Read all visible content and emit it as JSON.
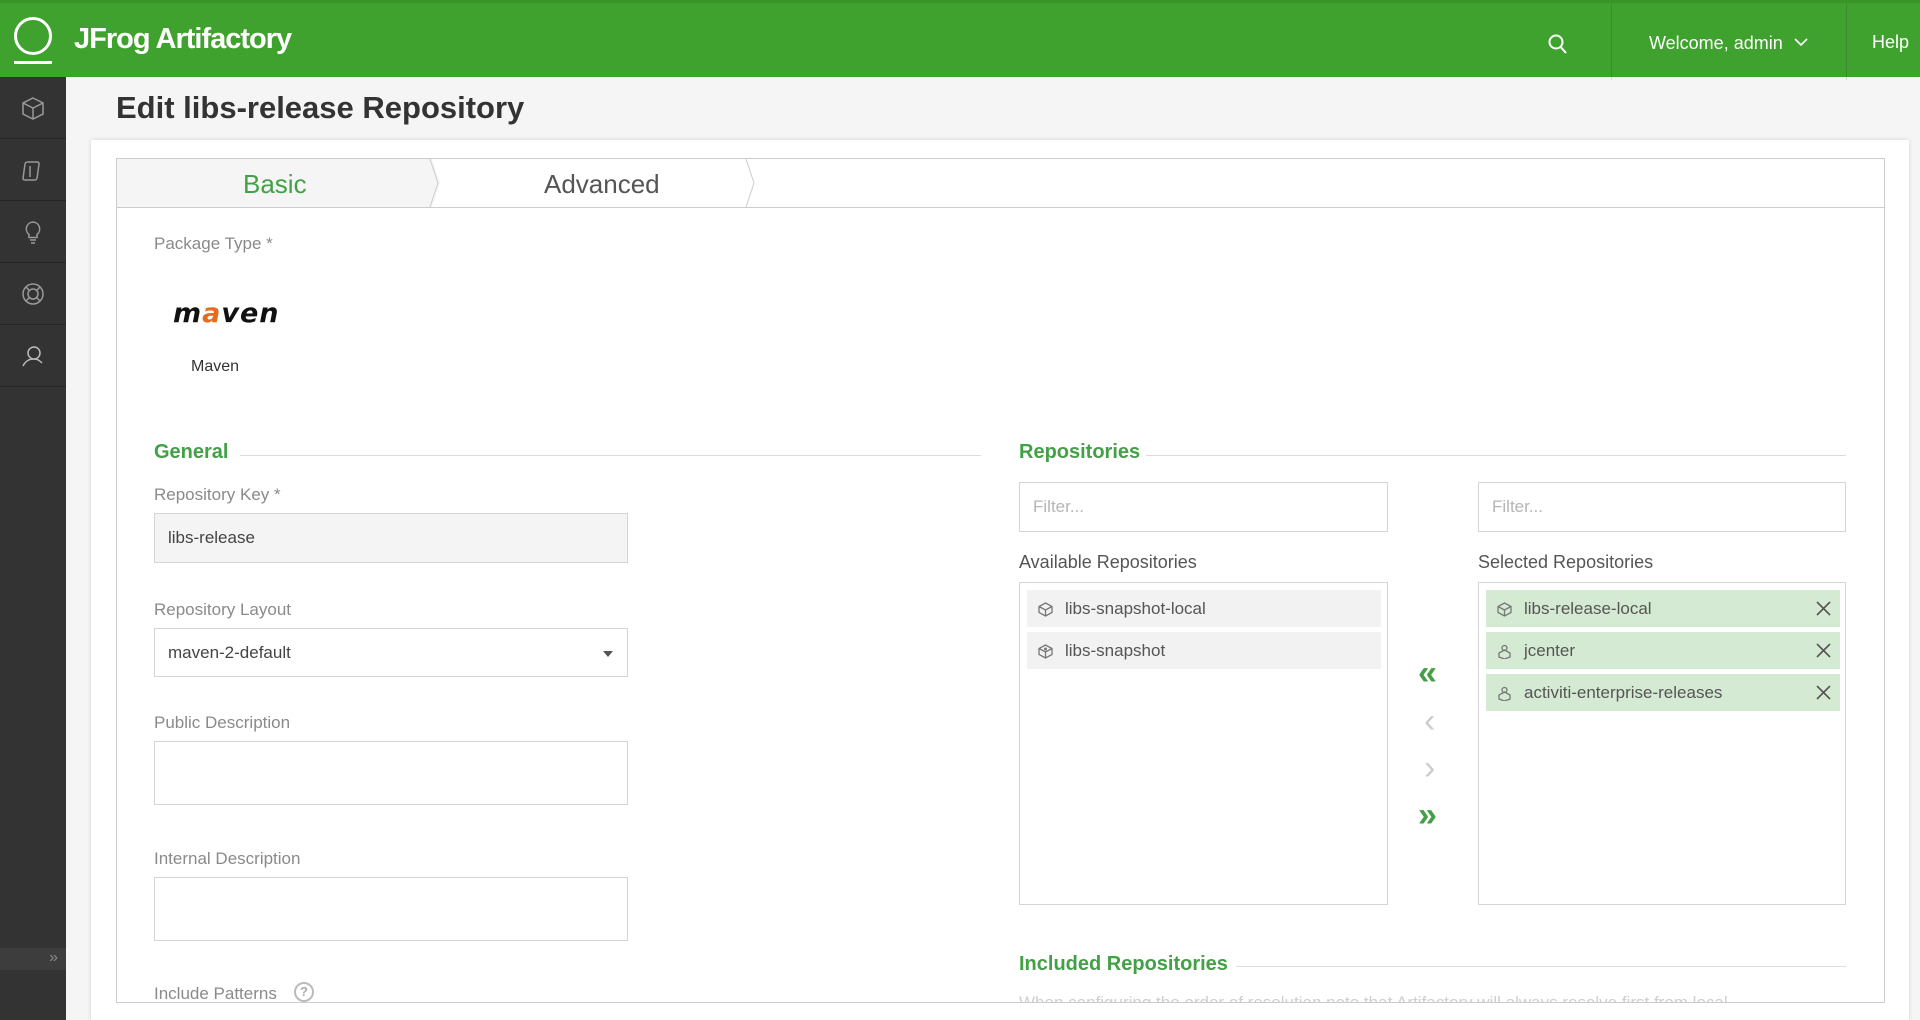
{
  "header": {
    "brand": "JFrog Artifactory",
    "welcome": "Welcome, admin",
    "help": "Help"
  },
  "sidebar": {
    "items": [
      {
        "icon": "cube-icon",
        "name": "artifacts"
      },
      {
        "icon": "package-icon",
        "name": "builds"
      },
      {
        "icon": "lightbulb-icon",
        "name": "home"
      },
      {
        "icon": "lifebuoy-icon",
        "name": "support"
      },
      {
        "icon": "admin-user-icon",
        "name": "admin"
      }
    ],
    "expand_label": "»"
  },
  "page": {
    "title": "Edit libs-release Repository"
  },
  "tabs": [
    {
      "label": "Basic",
      "active": true
    },
    {
      "label": "Advanced",
      "active": false
    }
  ],
  "basic": {
    "package_type_label": "Package Type *",
    "package_logo": "maven",
    "package_name": "Maven",
    "general_title": "General",
    "repo_key_label": "Repository Key *",
    "repo_key_value": "libs-release",
    "layout_label": "Repository Layout",
    "layout_value": "maven-2-default",
    "public_desc_label": "Public Description",
    "internal_desc_label": "Internal Description",
    "include_patterns_label": "Include Patterns"
  },
  "repositories": {
    "title": "Repositories",
    "available_filter_placeholder": "Filter...",
    "selected_filter_placeholder": "Filter...",
    "available_label": "Available Repositories",
    "selected_label": "Selected Repositories",
    "available": [
      "libs-snapshot-local",
      "libs-snapshot"
    ],
    "selected": [
      "libs-release-local",
      "jcenter",
      "activiti-enterprise-releases"
    ],
    "included_title": "Included Repositories",
    "included_note": "When configuring the order of resolution note that Artifactory will always resolve first from local"
  },
  "colors": {
    "brand_green": "#40a22e",
    "accent_green": "#43a047",
    "selected_bg": "#d5ead3",
    "sidebar": "#333333"
  }
}
